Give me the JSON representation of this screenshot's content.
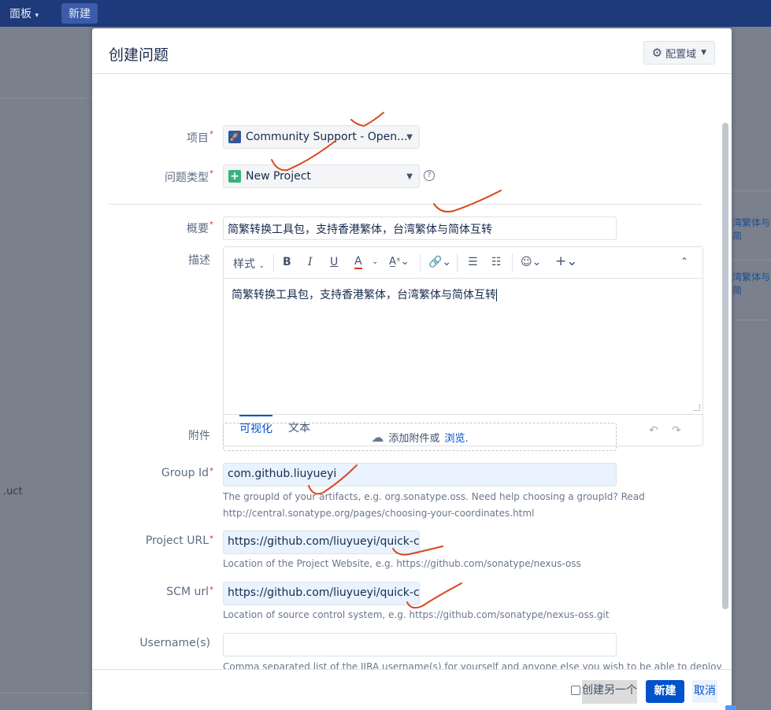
{
  "topnav": {
    "dashboard": "面板",
    "new": "新建"
  },
  "background": {
    "left_text": ".uct",
    "right_link_1": "湾繁体与简",
    "right_link_2": "湾繁体与简"
  },
  "dialog": {
    "title": "创建问题",
    "config_label": "配置域",
    "fields": {
      "project": {
        "label": "项目",
        "value": "Community Support - Open..."
      },
      "issue_type": {
        "label": "问题类型",
        "value": "New Project"
      },
      "summary": {
        "label": "概要",
        "value": "简繁转换工具包，支持香港繁体，台湾繁体与简体互转"
      },
      "description": {
        "label": "描述",
        "content": "简繁转换工具包，支持香港繁体，台湾繁体与简体互转",
        "toolbar": {
          "style": "样式"
        },
        "tab_visual": "可视化",
        "tab_text": "文本"
      },
      "attachment": {
        "label": "附件",
        "prompt": "添加附件或",
        "browse": "浏览."
      },
      "group_id": {
        "label": "Group Id",
        "value": "com.github.liuyueyi",
        "help_line1": "The groupId of your artifacts, e.g. org.sonatype.oss. Need help choosing a groupId? Read",
        "help_line2": "http://central.sonatype.org/pages/choosing-your-coordinates.html"
      },
      "project_url": {
        "label": "Project URL",
        "value": "https://github.com/liuyueyi/quick-chi",
        "help": "Location of the Project Website, e.g. https://github.com/sonatype/nexus-oss"
      },
      "scm_url": {
        "label": "SCM url",
        "value": "https://github.com/liuyueyi/quick-chi",
        "help": "Location of source control system, e.g. https://github.com/sonatype/nexus-oss.git"
      },
      "usernames": {
        "label": "Username(s)",
        "value": "",
        "help": "Comma separated list of the JIRA username(s) for yourself and anyone else you wish to be able to deploy"
      }
    },
    "footer": {
      "create_another": "创建另一个",
      "create": "新建",
      "cancel": "取消"
    }
  },
  "colors": {
    "primary": "#0052cc",
    "annotation": "#d9481c",
    "topbar": "#1e3a7a"
  }
}
